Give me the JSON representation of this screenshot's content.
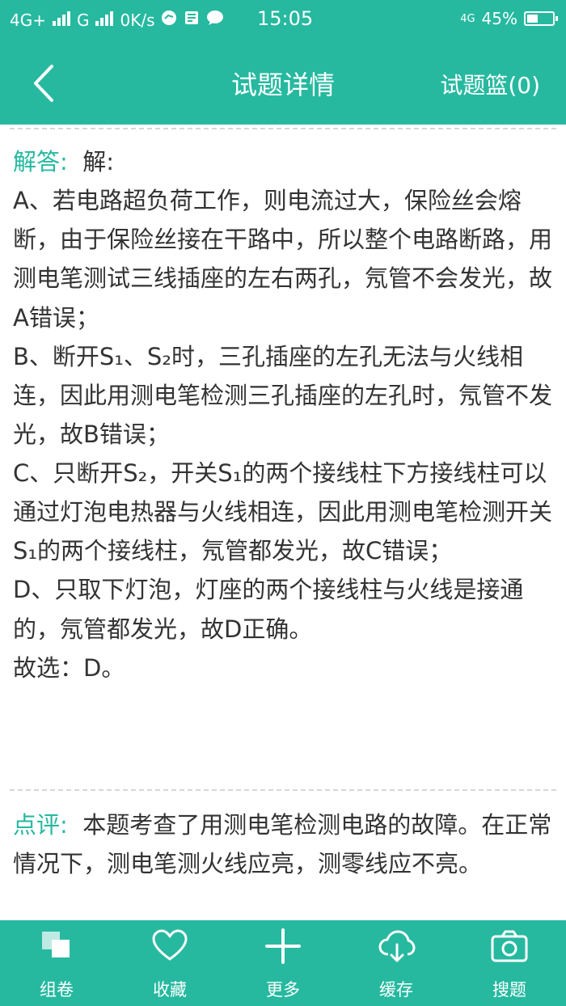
{
  "status_bar": {
    "network1": "4G+",
    "network2": "G",
    "speed": "0K/s",
    "time": "15:05",
    "network_right": "4G",
    "battery": "45%"
  },
  "header": {
    "title": "试题详情",
    "basket_label": "试题篮(0)"
  },
  "answer": {
    "label": "解答:",
    "intro": "解:",
    "options": [
      "A、若电路超负荷工作，则电流过大，保险丝会熔断，由于保险丝接在干路中，所以整个电路断路，用测电笔测试三线插座的左右两孔，氖管不会发光，故A错误；",
      "B、断开S₁、S₂时，三孔插座的左孔无法与火线相连，因此用测电笔检测三孔插座的左孔时，氖管不发光，故B错误；",
      "C、只断开S₂，开关S₁的两个接线柱下方接线柱可以通过灯泡电热器与火线相连，因此用测电笔检测开关S₁的两个接线柱，氖管都发光，故C错误；",
      "D、只取下灯泡，灯座的两个接线柱与火线是接通的，氖管都发光，故D正确。"
    ],
    "conclusion": "故选：D。"
  },
  "comment": {
    "label": "点评:",
    "text": "本题考查了用测电笔检测电路的故障。在正常情况下，测电笔测火线应亮，测零线应不亮。"
  },
  "tabs": [
    {
      "label": "组卷",
      "icon": "compose-paper-icon"
    },
    {
      "label": "收藏",
      "icon": "heart-icon"
    },
    {
      "label": "更多",
      "icon": "plus-icon"
    },
    {
      "label": "缓存",
      "icon": "cloud-download-icon"
    },
    {
      "label": "搜题",
      "icon": "camera-icon"
    }
  ],
  "colors": {
    "accent": "#26b9a0"
  }
}
